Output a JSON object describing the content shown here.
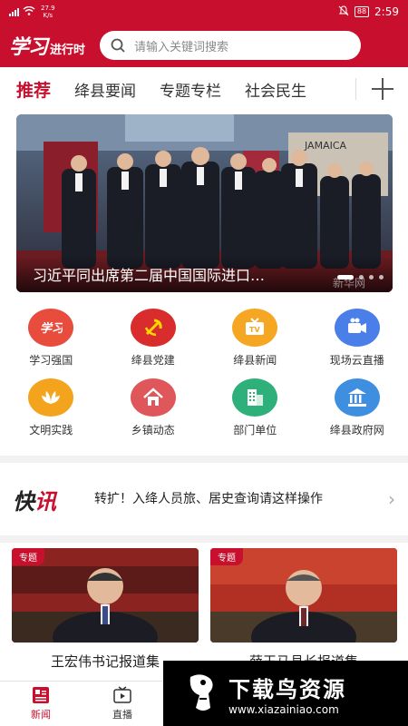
{
  "status_bar": {
    "network_speed_value": "27.9",
    "network_speed_unit": "K/s",
    "battery": "88",
    "time": "2:59"
  },
  "header": {
    "logo_script": "学习",
    "logo_sub": "进行时",
    "search_placeholder": "请输入关键词搜索",
    "search_icon": "search-icon"
  },
  "tabs": {
    "items": [
      {
        "label": "推荐",
        "active": true
      },
      {
        "label": "绛县要闻",
        "active": false
      },
      {
        "label": "专题专栏",
        "active": false
      },
      {
        "label": "社会民生",
        "active": false
      }
    ],
    "add_icon": "plus-icon"
  },
  "banner": {
    "title": "习近平同出席第二届中国国际进口博览会的外国领导人",
    "watermark": "新华网",
    "slide_count": 4,
    "active_slide": 1
  },
  "shortcuts": [
    {
      "label": "学习强国",
      "icon": "xuexi-logo-icon",
      "color": "#e84c3d"
    },
    {
      "label": "绛县党建",
      "icon": "party-emblem-icon",
      "color": "#d92c2c"
    },
    {
      "label": "绛县新闻",
      "icon": "tv-icon",
      "color": "#f5a623"
    },
    {
      "label": "现场云直播",
      "icon": "video-camera-icon",
      "color": "#4a7ee8"
    },
    {
      "label": "文明实践",
      "icon": "lotus-icon",
      "color": "#f3a31c"
    },
    {
      "label": "乡镇动态",
      "icon": "house-icon",
      "color": "#e0575b"
    },
    {
      "label": "部门单位",
      "icon": "building-icon",
      "color": "#2db07a"
    },
    {
      "label": "绛县政府网",
      "icon": "government-building-icon",
      "color": "#3f8fe0"
    }
  ],
  "news_flash": {
    "logo_first": "快",
    "logo_second": "讯",
    "text": "转扩！入绛人员旅、居史查询请这样操作"
  },
  "cards": [
    {
      "tag": "专题",
      "title": "王宏伟书记报道集"
    },
    {
      "tag": "专题",
      "title": "薛玉马县长报道集"
    }
  ],
  "bottom_nav": [
    {
      "label": "新闻",
      "icon": "news-icon",
      "active": true
    },
    {
      "label": "直播",
      "icon": "tv-play-icon",
      "active": false
    }
  ],
  "download_overlay": {
    "title": "下载鸟资源",
    "url": "www.xiazainiao.com"
  },
  "colors": {
    "brand_red": "#c8102e"
  }
}
